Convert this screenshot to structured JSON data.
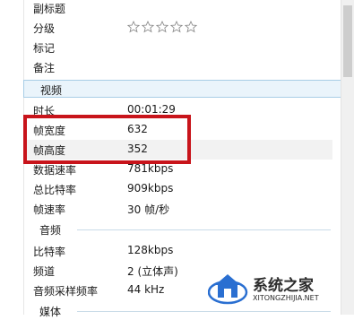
{
  "rows_top": [
    {
      "name": "副标题",
      "value": ""
    },
    {
      "name": "分级",
      "value": ""
    },
    {
      "name": "标记",
      "value": ""
    },
    {
      "name": "备注",
      "value": ""
    }
  ],
  "rating": {
    "filled": 0,
    "max": 5
  },
  "video": {
    "title": "视频",
    "rows": [
      {
        "name": "时长",
        "value": "00:01:29"
      },
      {
        "name": "帧宽度",
        "value": "632"
      },
      {
        "name": "帧高度",
        "value": "352"
      },
      {
        "name": "数据速率",
        "value": "781kbps"
      },
      {
        "name": "总比特率",
        "value": "909kbps"
      },
      {
        "name": "帧速率",
        "value": "30 帧/秒"
      }
    ]
  },
  "audio": {
    "title": "音频",
    "rows": [
      {
        "name": "比特率",
        "value": "128kbps"
      },
      {
        "name": "频道",
        "value": "2 (立体声)"
      },
      {
        "name": "音频采样频率",
        "value": "44 kHz"
      }
    ]
  },
  "media": {
    "title": "媒体"
  },
  "watermark": {
    "text": "系统之家",
    "url": "XITONGZHIJIA.NET"
  },
  "colors": {
    "highlight_box": "#c8141b",
    "section_header_bg": "#eaf4fb"
  }
}
